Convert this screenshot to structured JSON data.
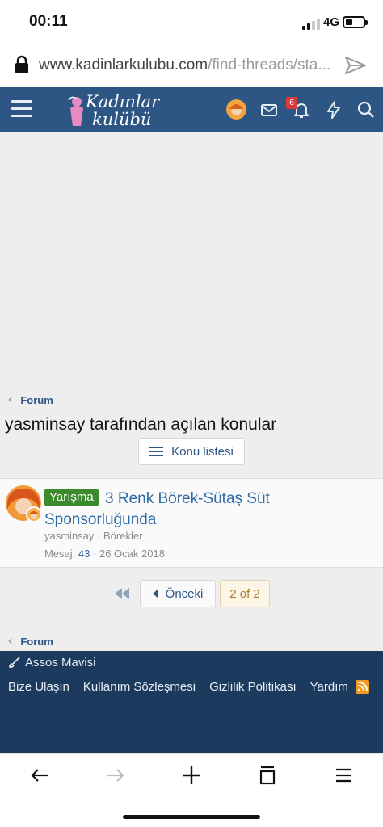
{
  "status_bar": {
    "time": "00:11",
    "network": "4G"
  },
  "browser": {
    "url_domain": "www.kadinlarkulubu.com",
    "url_path": "/find-threads/sta..."
  },
  "nav": {
    "logo_line1": "Kadınlar",
    "logo_line2": "kulübü",
    "notification_count": "6"
  },
  "breadcrumb": {
    "top": "Forum",
    "bottom": "Forum"
  },
  "page": {
    "title": "yasminsay tarafından açılan konular",
    "list_button": "Konu listesi"
  },
  "thread": {
    "prefix": "Yarışma",
    "title": "3 Renk Börek-Sütaş Süt Sponsorluğunda",
    "author": "yasminsay",
    "separator": "·",
    "forum": "Börekler",
    "replies_label": "Mesaj:",
    "replies": "43",
    "date": "26 Ocak 2018"
  },
  "pagination": {
    "prev_label": "Önceki",
    "current": "2 of 2"
  },
  "footer": {
    "style_name": "Assos Mavisi",
    "links": [
      "Bize Ulaşın",
      "Kullanım Sözleşmesi",
      "Gizlilik Politikası",
      "Yardım"
    ]
  },
  "colors": {
    "nav": "#2d5684",
    "footer": "#1c3a5e",
    "link": "#2d6ba8",
    "prefix": "#3c8a2e"
  }
}
